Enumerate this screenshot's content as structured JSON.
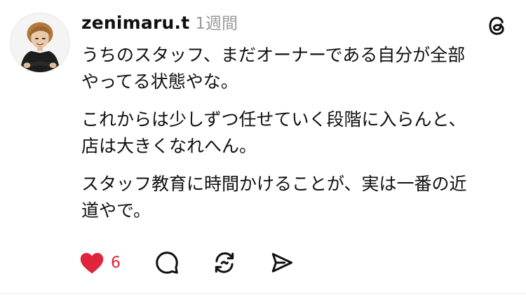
{
  "post": {
    "username": "zenimaru.t",
    "time": "1週間",
    "paragraphs": [
      "うちのスタッフ、まだオーナーである自分が全部\nやってる状態やな。",
      "これからは少しずつ任せていく段階に入らんと、\n店は大きくなれへん。",
      "スタッフ教育に時間かけることが、実は一番の近\n道やで。"
    ],
    "like_count": "6"
  },
  "icons": {
    "like": "heart-icon",
    "reply": "reply-bubble-icon",
    "repost": "repost-icon",
    "share": "send-icon",
    "brand": "threads-logo-icon"
  },
  "colors": {
    "like": "#e0243b",
    "meta": "#9a9a9a",
    "text": "#101010"
  }
}
